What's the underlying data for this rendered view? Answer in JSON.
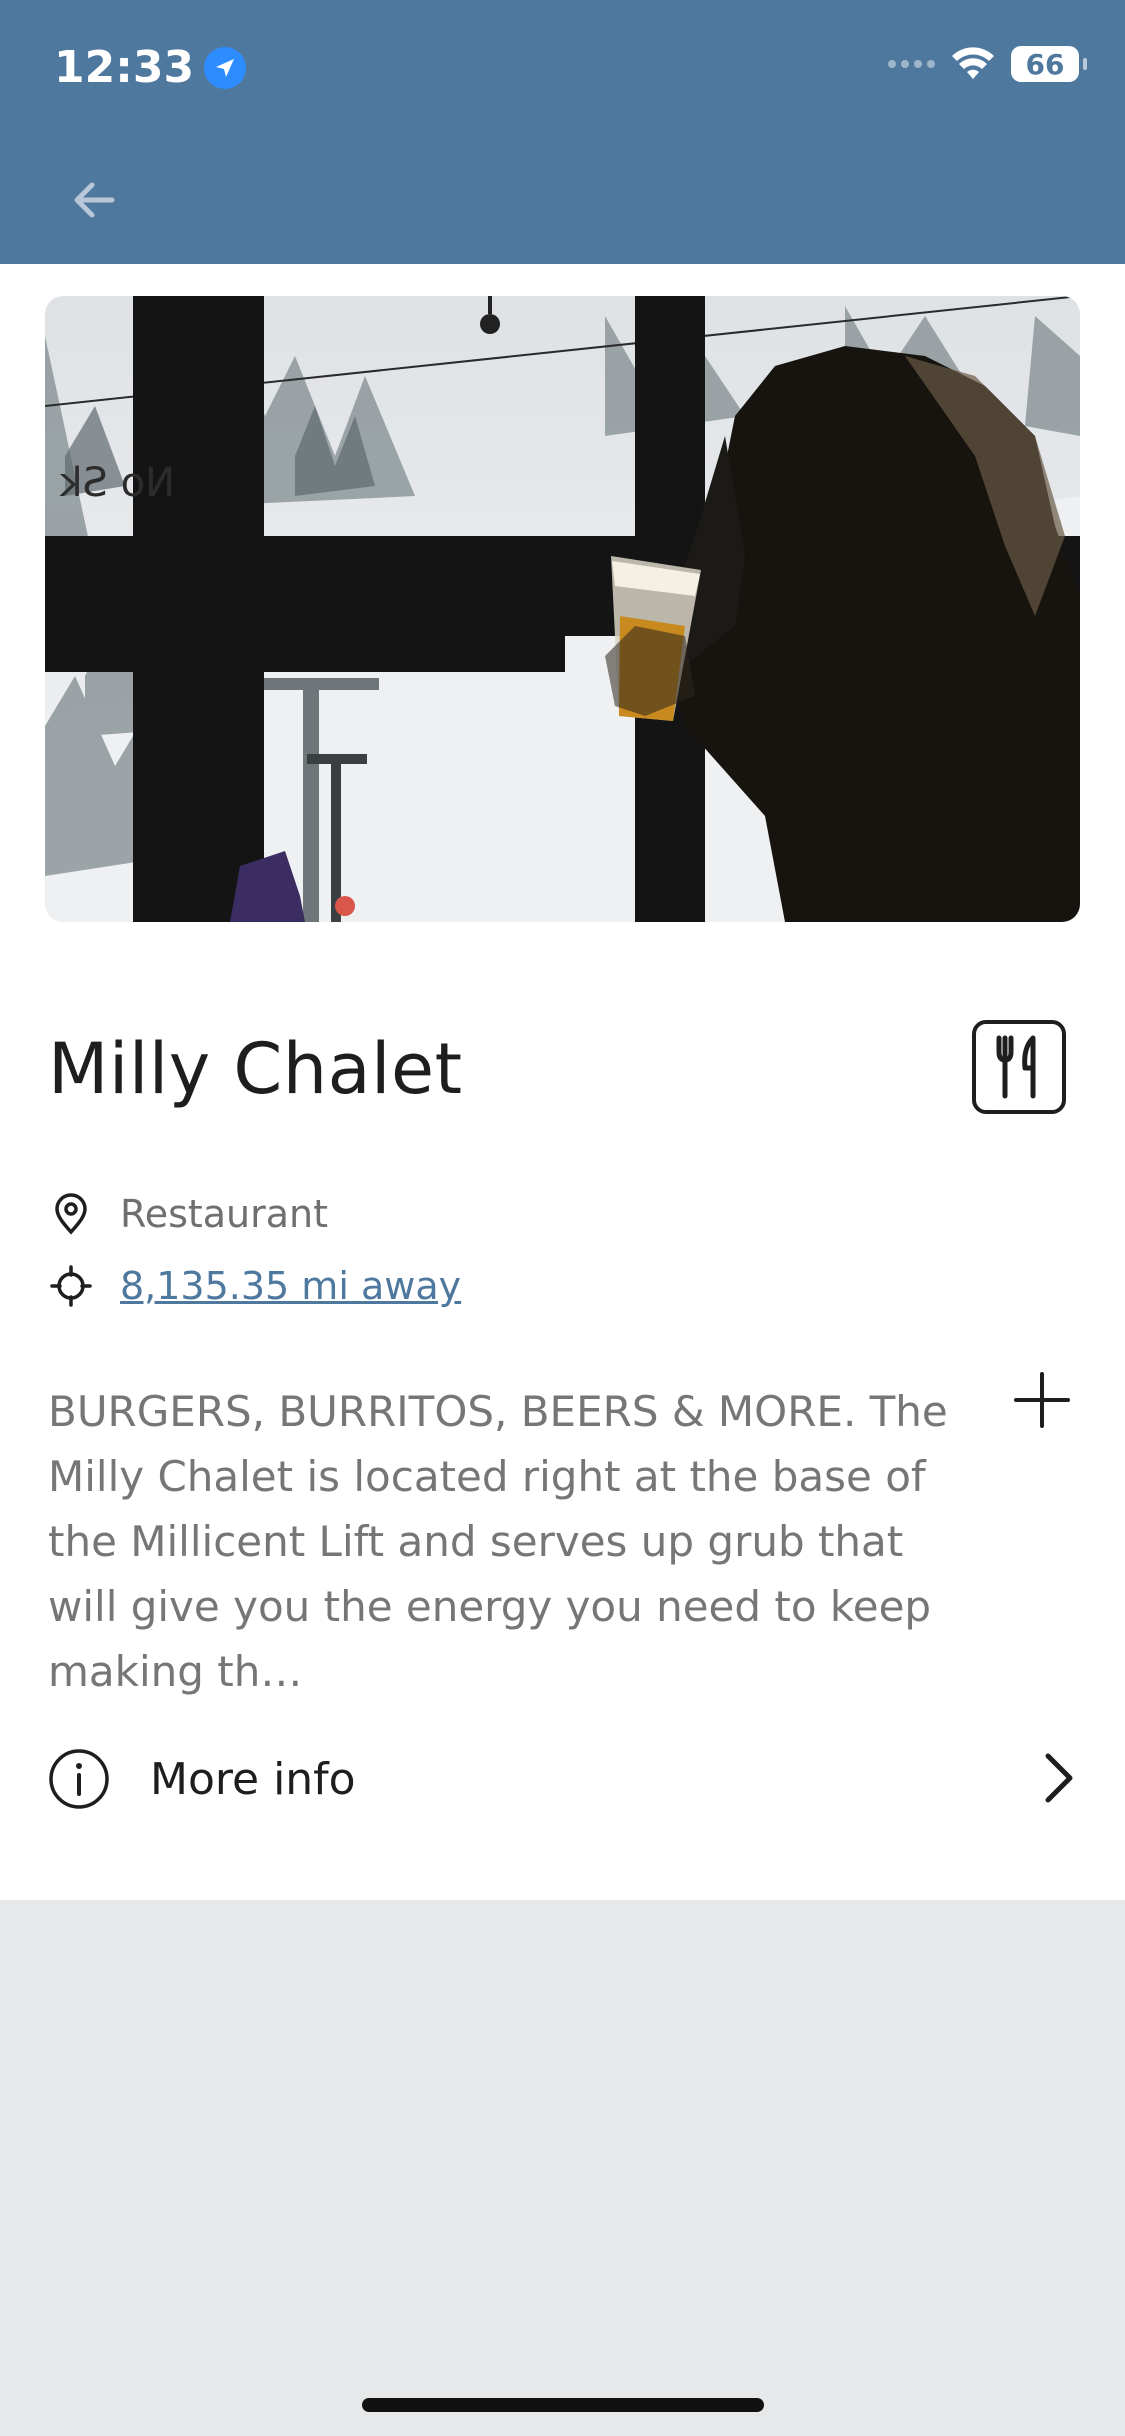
{
  "status_bar": {
    "time": "12:33",
    "battery": "66"
  },
  "header": {
    "back_icon": "arrow-left-icon"
  },
  "place": {
    "title": "Milly Chalet",
    "category_icon": "fork-knife-icon",
    "category": "Restaurant",
    "distance": "8,135.35 mi away",
    "description": "BURGERS, BURRITOS, BEERS & MORE. The Milly Chalet is located right at the base of the Millicent Lift and serves up grub that will give you the energy you need to keep making th…",
    "more_info_label": "More info"
  },
  "colors": {
    "header_bg": "#4f789f",
    "link": "#4f789f",
    "page_bg": "#e6e8ea"
  }
}
